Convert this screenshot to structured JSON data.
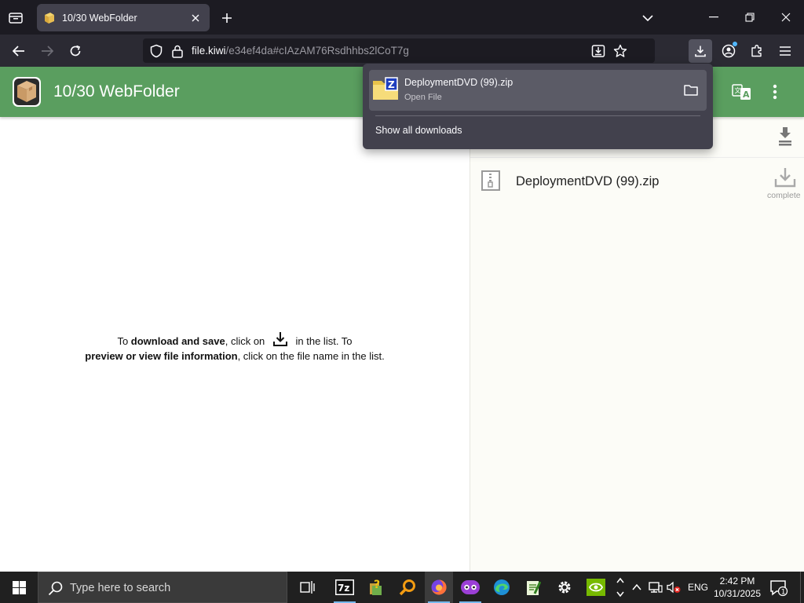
{
  "browser": {
    "tab": {
      "title": "10/30 WebFolder"
    },
    "url": {
      "host": "file.kiwi",
      "path": "/e34ef4da#cIAzAM76Rsdhhbs2lCoT7g"
    }
  },
  "page": {
    "title": "10/30 WebFolder",
    "file": {
      "name": "DeploymentDVD (99).zip",
      "status": "complete"
    },
    "instructions": {
      "part1": "To ",
      "bold1": "download and save",
      "part2": ", click on ",
      "part3": " in the list. To",
      "bold2": "preview or view file information",
      "part4": ", click on the file name in the list."
    }
  },
  "downloads_panel": {
    "item": {
      "name": "DeploymentDVD (99).zip",
      "status": "Open File"
    },
    "show_all": "Show all downloads"
  },
  "taskbar": {
    "search_placeholder": "Type here to search",
    "language": "ENG",
    "time": "2:42 PM",
    "date": "10/31/2025",
    "notification_count": "1"
  },
  "colors": {
    "header_green": "#5a9e5f",
    "tab_active": "#42414d",
    "chrome_dark": "#1c1b22",
    "toolbar": "#2b2a33",
    "accent_blue": "#76b9ed"
  }
}
